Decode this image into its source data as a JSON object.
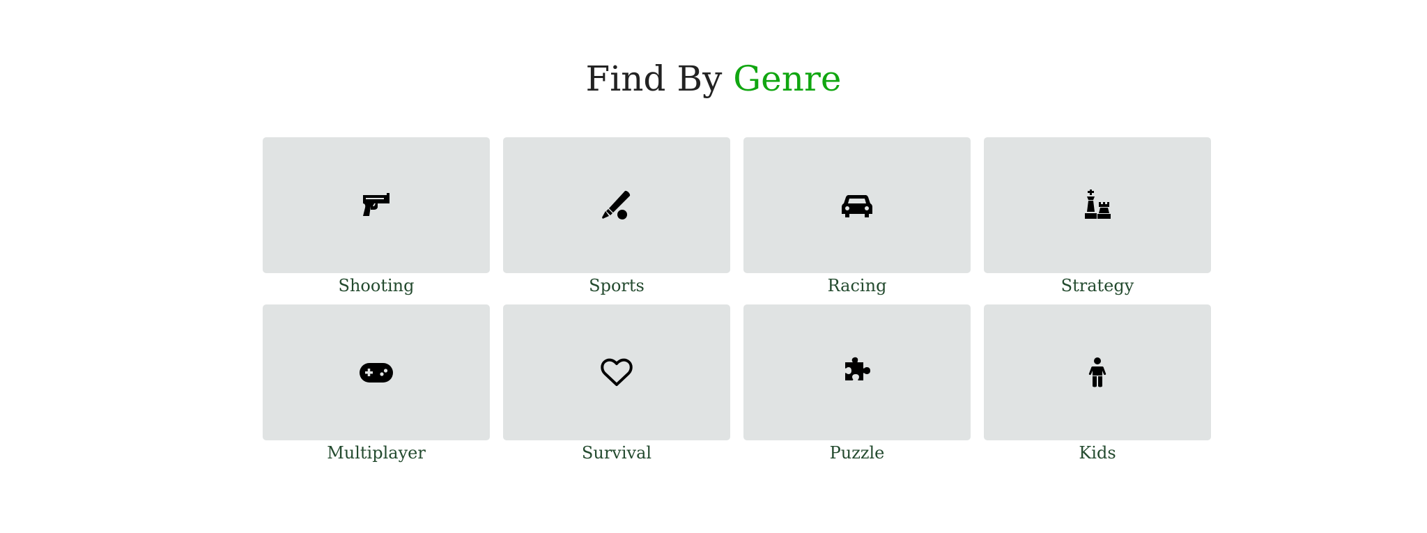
{
  "header": {
    "title_part1": "Find By ",
    "title_part2": "Genre"
  },
  "colors": {
    "accent": "#11a611",
    "tile_bg": "#e0e3e3",
    "label": "#234a2e",
    "title": "#222222"
  },
  "genres": [
    {
      "label": "Shooting",
      "icon": "pistol-icon"
    },
    {
      "label": "Sports",
      "icon": "baseball-bat-ball-icon"
    },
    {
      "label": "Racing",
      "icon": "car-icon"
    },
    {
      "label": "Strategy",
      "icon": "chess-pieces-icon"
    },
    {
      "label": "Multiplayer",
      "icon": "gamepad-icon"
    },
    {
      "label": "Survival",
      "icon": "heart-icon"
    },
    {
      "label": "Puzzle",
      "icon": "puzzle-piece-icon"
    },
    {
      "label": "Kids",
      "icon": "child-icon"
    }
  ]
}
